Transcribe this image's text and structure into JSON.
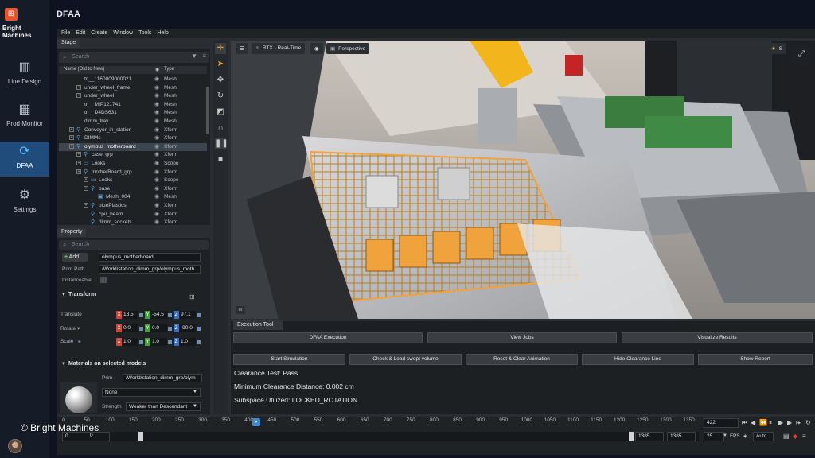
{
  "brand": {
    "name_line1": "Bright",
    "name_line2": "Machines",
    "logo_glyph": "⊞"
  },
  "sidebar": {
    "items": [
      {
        "label": "Line Design",
        "icon": "line-design-icon",
        "glyph": "▥"
      },
      {
        "label": "Prod Monitor",
        "icon": "monitor-chart-icon",
        "glyph": "▦"
      },
      {
        "label": "DFAA",
        "icon": "sync-arrows-icon",
        "glyph": "⟳",
        "active": true
      },
      {
        "label": "Settings",
        "icon": "gear-icon",
        "glyph": "⚙"
      }
    ]
  },
  "header": {
    "title": "DFAA"
  },
  "menu": {
    "items": [
      "File",
      "Edit",
      "Create",
      "Window",
      "Tools",
      "Help"
    ]
  },
  "stage": {
    "tab": "Stage",
    "search_placeholder": "Search",
    "columns": {
      "name": "Name (Old to New)",
      "type": "Type"
    },
    "rows": [
      {
        "name": "tn__1160009000021",
        "type": "Mesh",
        "level": 2,
        "expander": false,
        "icon": ""
      },
      {
        "name": "under_wheel_frame",
        "type": "Mesh",
        "level": 2,
        "expander": true,
        "icon": ""
      },
      {
        "name": "under_wheel",
        "type": "Mesh",
        "level": 2,
        "expander": true,
        "icon": ""
      },
      {
        "name": "tn__MIP121741",
        "type": "Mesh",
        "level": 2,
        "expander": false,
        "icon": ""
      },
      {
        "name": "tn__D4DS631",
        "type": "Mesh",
        "level": 2,
        "expander": false,
        "icon": ""
      },
      {
        "name": "dimm_tray",
        "type": "Mesh",
        "level": 2,
        "expander": false,
        "icon": ""
      },
      {
        "name": "Conveyor_in_station",
        "type": "Xform",
        "level": 1,
        "expander": true,
        "icon": "xform"
      },
      {
        "name": "DIMMs",
        "type": "Xform",
        "level": 1,
        "expander": true,
        "icon": "xform"
      },
      {
        "name": "olympus_motherboard",
        "type": "Xform",
        "level": 1,
        "expander": true,
        "icon": "xform",
        "selected": true
      },
      {
        "name": "case_grp",
        "type": "Xform",
        "level": 2,
        "expander": true,
        "icon": "xform"
      },
      {
        "name": "Looks",
        "type": "Scope",
        "level": 2,
        "expander": true,
        "icon": "folder"
      },
      {
        "name": "motherBoard_grp",
        "type": "Xform",
        "level": 2,
        "expander": true,
        "icon": "xform"
      },
      {
        "name": "Looks",
        "type": "Scope",
        "level": 3,
        "expander": true,
        "icon": "folder"
      },
      {
        "name": "base",
        "type": "Xform",
        "level": 3,
        "expander": true,
        "icon": "xform"
      },
      {
        "name": "Mesh_004",
        "type": "Mesh",
        "level": 4,
        "expander": false,
        "icon": "mesh"
      },
      {
        "name": "bluePlastics",
        "type": "Xform",
        "level": 3,
        "expander": true,
        "icon": "xform"
      },
      {
        "name": "cpu_beam",
        "type": "Xform",
        "level": 3,
        "expander": false,
        "icon": "xform"
      },
      {
        "name": "dimm_sockets",
        "type": "Xform",
        "level": 3,
        "expander": false,
        "icon": "xform"
      }
    ]
  },
  "property": {
    "tab": "Property",
    "search_placeholder": "Search",
    "add_label": "Add",
    "prim_name": "olympus_motherboard",
    "prim_path_label": "Prim Path",
    "prim_path": "/World/station_dimm_grp/olympus_moth",
    "instanceable_label": "Instanceable",
    "transform_title": "Transform",
    "translate_label": "Translate",
    "rotate_label": "Rotate ▾",
    "scale_label": "Scale",
    "translate": {
      "x": "18.5",
      "y": "-54.5",
      "z": "97.1"
    },
    "rotate": {
      "x": "0.0",
      "y": "0.0",
      "z": "-90.0"
    },
    "scale": {
      "x": "1.0",
      "y": "1.0",
      "z": "1.0"
    },
    "axis_x": "X",
    "axis_y": "Y",
    "axis_z": "Z",
    "materials_title": "Materials on selected models",
    "prim_label": "Prim",
    "material_prim": "/World/station_dimm_grp/olym",
    "material_value": "None",
    "strength_label": "Strength",
    "strength_value": "Weaker than Descendant"
  },
  "viewport": {
    "render_mode": "RTX - Real-Time",
    "camera": "Perspective",
    "settings_label": "S",
    "m_label": "m"
  },
  "exec": {
    "tab": "Execution Tool",
    "row1": [
      "DFAA Execution",
      "View Jobs",
      "Visualize Results"
    ],
    "row2": [
      "Start Simulation",
      "Check & Load swept volume",
      "Reset & Clear Animation",
      "Hide Clearance Line",
      "Show Report"
    ],
    "status": [
      "Clearance Test: Pass",
      "Minimum Clearance Distance: 0.002 cm",
      "Subspace Utilized: LOCKED_ROTATION"
    ]
  },
  "timeline": {
    "ticks": [
      "0",
      "50",
      "100",
      "150",
      "200",
      "250",
      "300",
      "350",
      "400",
      "450",
      "500",
      "550",
      "600",
      "650",
      "700",
      "750",
      "800",
      "850",
      "900",
      "950",
      "1000",
      "1050",
      "1100",
      "1150",
      "1200",
      "1250",
      "1300",
      "1350"
    ],
    "current_frame": "422",
    "start": "0",
    "start2": "0",
    "end": "1385",
    "end2": "1385",
    "fps": "25",
    "fps_label": "FPS",
    "auto_label": "Auto"
  },
  "watermark": "© Bright Machines",
  "colors": {
    "accent": "#1f4c7a",
    "highlight": "#f0a23c"
  }
}
